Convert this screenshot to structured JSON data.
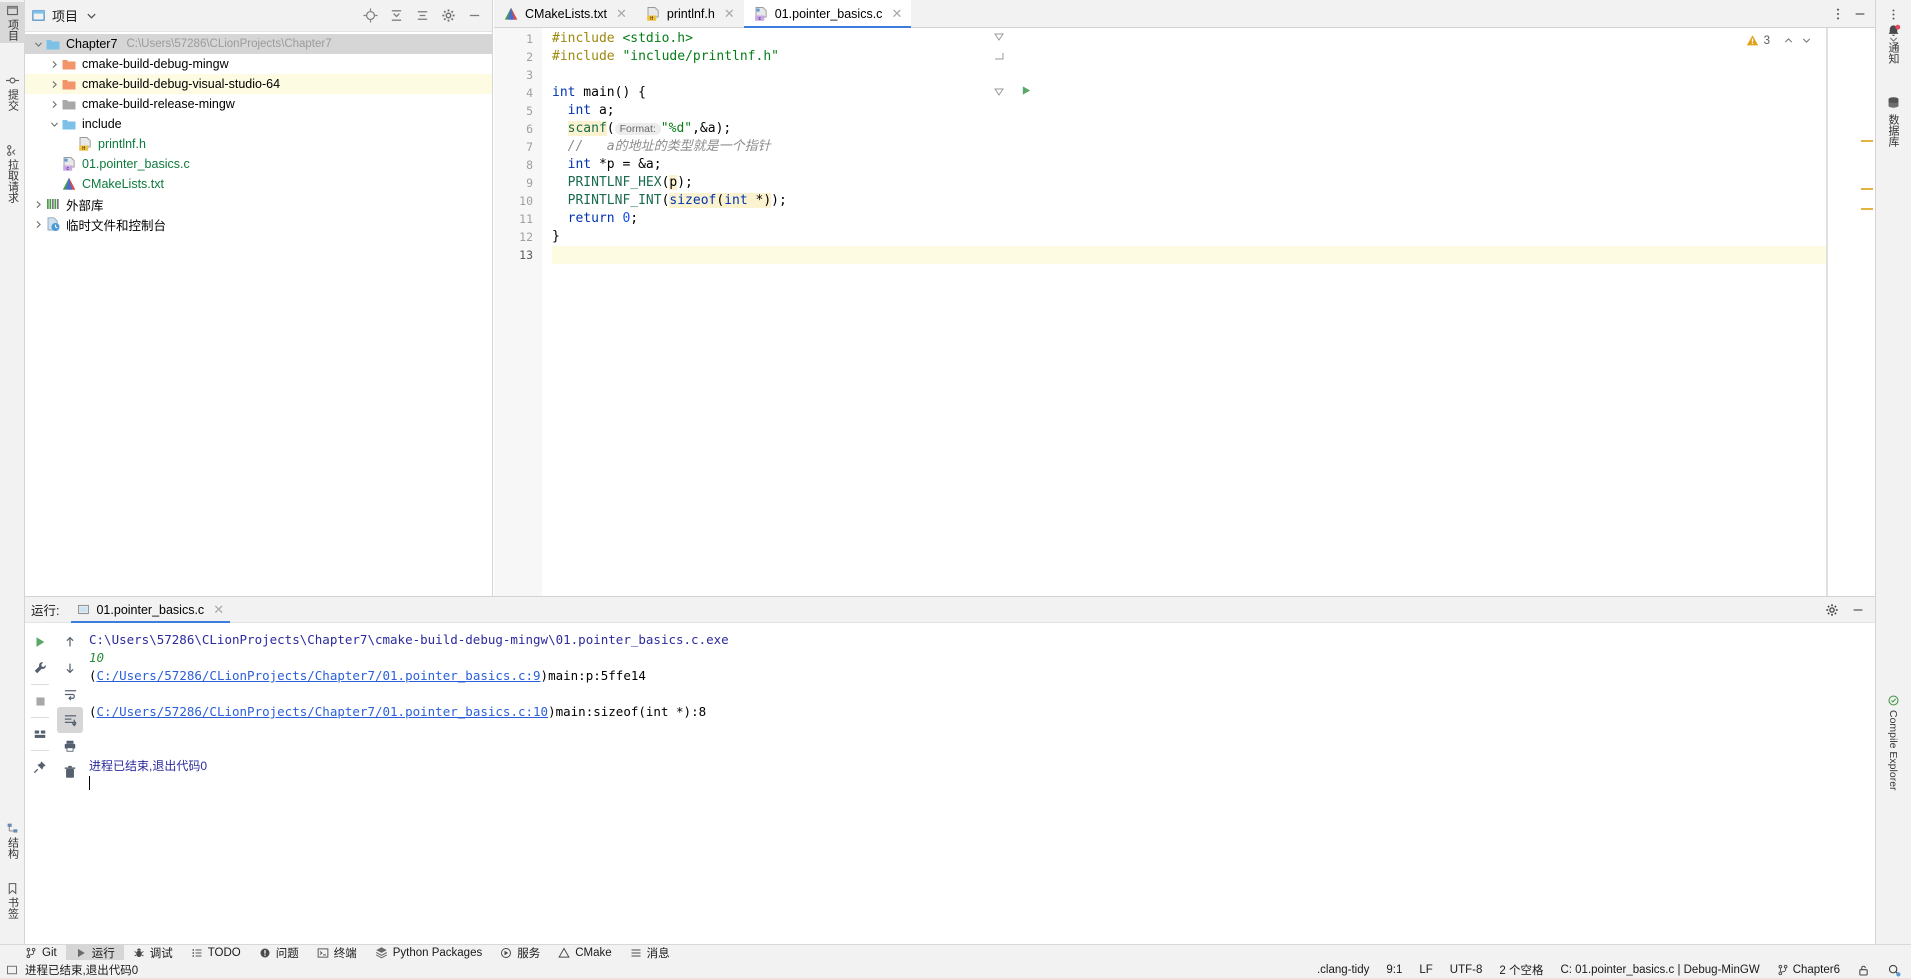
{
  "left_rail": {
    "items": [
      {
        "label": "项目",
        "icon": "project-icon",
        "selected": true
      },
      {
        "label": "提交",
        "icon": "commit-icon",
        "selected": false
      },
      {
        "label": "拉取请求",
        "icon": "pull-request-icon",
        "selected": false
      }
    ],
    "bottom_items": [
      {
        "label": "结构",
        "icon": "structure-icon"
      },
      {
        "label": "书签",
        "icon": "bookmarks-icon"
      }
    ]
  },
  "project_panel": {
    "title": "项目",
    "dropdown_icon": "chevron-down-icon",
    "header_icons": [
      "locate-icon",
      "collapse-all-icon",
      "expand-icon",
      "gear-icon",
      "minimize-icon"
    ],
    "tree": [
      {
        "label": "Chapter7",
        "path": "C:\\Users\\57286\\CLionProjects\\Chapter7",
        "icon": "folder-icon",
        "indent": 0,
        "arrow": "down",
        "state": "selected"
      },
      {
        "label": "cmake-build-debug-mingw",
        "icon": "folder-excluded-icon",
        "indent": 1,
        "arrow": "right",
        "state": "normal"
      },
      {
        "label": "cmake-build-debug-visual-studio-64",
        "icon": "folder-excluded-icon",
        "indent": 1,
        "arrow": "right",
        "state": "highlight"
      },
      {
        "label": "cmake-build-release-mingw",
        "icon": "folder-gray-icon",
        "indent": 1,
        "arrow": "right",
        "state": "normal"
      },
      {
        "label": "include",
        "icon": "folder-icon",
        "indent": 1,
        "arrow": "down",
        "state": "normal"
      },
      {
        "label": "printlnf.h",
        "icon": "header-file-icon",
        "indent": 2,
        "arrow": "none",
        "state": "normal",
        "color": "green"
      },
      {
        "label": "01.pointer_basics.c",
        "icon": "c-file-icon",
        "indent": 1,
        "arrow": "none",
        "state": "normal",
        "color": "green"
      },
      {
        "label": "CMakeLists.txt",
        "icon": "cmake-file-icon",
        "indent": 1,
        "arrow": "none",
        "state": "normal",
        "color": "green"
      },
      {
        "label": "外部库",
        "icon": "library-icon",
        "indent": 0,
        "arrow": "right",
        "state": "normal"
      },
      {
        "label": "临时文件和控制台",
        "icon": "scratches-icon",
        "indent": 0,
        "arrow": "right",
        "state": "normal"
      }
    ]
  },
  "editor": {
    "tabs": [
      {
        "label": "CMakeLists.txt",
        "icon": "cmake-file-icon",
        "active": false,
        "closable": true
      },
      {
        "label": "printlnf.h",
        "icon": "header-file-icon",
        "active": false,
        "closable": true
      },
      {
        "label": "01.pointer_basics.c",
        "icon": "c-file-icon",
        "active": true,
        "closable": true
      }
    ],
    "tab_right_icons": [
      "more-vertical-icon",
      "minimize-icon"
    ],
    "warning_count": "3",
    "warning_icon": "warning-triangle-icon",
    "nav_up_icon": "chevron-up-icon",
    "nav_down_icon": "chevron-down-icon",
    "line_numbers": [
      "1",
      "2",
      "3",
      "4",
      "5",
      "6",
      "7",
      "8",
      "9",
      "10",
      "11",
      "12",
      "13"
    ],
    "current_line": "13",
    "code_lines": [
      {
        "n": 1,
        "tokens": [
          {
            "t": "#include ",
            "c": "pp"
          },
          {
            "t": "<stdio.h>",
            "c": "str"
          }
        ]
      },
      {
        "n": 2,
        "tokens": [
          {
            "t": "#include ",
            "c": "pp"
          },
          {
            "t": "\"include/printlnf.h\"",
            "c": "str"
          }
        ]
      },
      {
        "n": 3,
        "tokens": []
      },
      {
        "n": 4,
        "tokens": [
          {
            "t": "int",
            "c": "k"
          },
          {
            "t": " main() {",
            "c": ""
          }
        ]
      },
      {
        "n": 5,
        "tokens": [
          {
            "t": "  ",
            "c": ""
          },
          {
            "t": "int",
            "c": "k"
          },
          {
            "t": " a;",
            "c": ""
          }
        ]
      },
      {
        "n": 6,
        "tokens": [
          {
            "t": "  ",
            "c": ""
          },
          {
            "t": "scanf",
            "c": "mac-hl"
          },
          {
            "t": "(",
            "c": ""
          },
          {
            "t": "Format:",
            "c": "inlay"
          },
          {
            "t": "\"%d\"",
            "c": "str"
          },
          {
            "t": ",&a);",
            "c": ""
          }
        ]
      },
      {
        "n": 7,
        "tokens": [
          {
            "t": "  //   a的地址的类型就是一个指针",
            "c": "cmt"
          }
        ]
      },
      {
        "n": 8,
        "tokens": [
          {
            "t": "  ",
            "c": ""
          },
          {
            "t": "int",
            "c": "k"
          },
          {
            "t": " *p = &a;",
            "c": ""
          }
        ]
      },
      {
        "n": 9,
        "tokens": [
          {
            "t": "  ",
            "c": ""
          },
          {
            "t": "PRINTLNF_HEX",
            "c": "mac"
          },
          {
            "t": "(",
            "c": ""
          },
          {
            "t": "p",
            "c": "hl"
          },
          {
            "t": ");",
            "c": ""
          }
        ]
      },
      {
        "n": 10,
        "tokens": [
          {
            "t": "  ",
            "c": ""
          },
          {
            "t": "PRINTLNF_INT",
            "c": "mac"
          },
          {
            "t": "(",
            "c": ""
          },
          {
            "t": "sizeof(int *)",
            "c": "hl-mixed"
          },
          {
            "t": ");",
            "c": ""
          }
        ]
      },
      {
        "n": 11,
        "tokens": [
          {
            "t": "  ",
            "c": ""
          },
          {
            "t": "return",
            "c": "k"
          },
          {
            "t": " ",
            "c": ""
          },
          {
            "t": "0",
            "c": "num"
          },
          {
            "t": ";",
            "c": ""
          }
        ]
      },
      {
        "n": 12,
        "tokens": [
          {
            "t": "}",
            "c": ""
          }
        ]
      },
      {
        "n": 13,
        "tokens": []
      }
    ]
  },
  "run_panel": {
    "label": "运行:",
    "tab_label": "01.pointer_basics.c",
    "tab_icon": "run-config-icon",
    "tab_close_icon": "close-icon",
    "header_right_icons": [
      "gear-icon",
      "minimize-icon"
    ],
    "toolbar_left": [
      {
        "icon": "rerun-icon",
        "name": "rerun-button"
      },
      {
        "icon": "wrench-icon",
        "name": "edit-configuration-button"
      },
      {
        "icon": "stop-icon",
        "name": "stop-button"
      },
      {
        "icon": "layout-icon",
        "name": "layout-button"
      },
      {
        "icon": "pin-icon",
        "name": "pin-button"
      }
    ],
    "toolbar_right": [
      {
        "icon": "arrow-up-icon",
        "name": "previous-occurrence-button"
      },
      {
        "icon": "arrow-down-icon",
        "name": "next-occurrence-button"
      },
      {
        "icon": "soft-wrap-icon",
        "name": "soft-wrap-button"
      },
      {
        "icon": "scroll-to-end-icon",
        "name": "scroll-to-end-button",
        "active": true
      },
      {
        "icon": "print-icon",
        "name": "print-button"
      },
      {
        "icon": "trash-icon",
        "name": "clear-all-button"
      }
    ],
    "console_lines": [
      {
        "kind": "cmd",
        "text": "C:\\Users\\57286\\CLionProjects\\Chapter7\\cmake-build-debug-mingw\\01.pointer_basics.c.exe"
      },
      {
        "kind": "input",
        "text": "10"
      },
      {
        "kind": "link",
        "prefix": "(",
        "link": "C:/Users/57286/CLionProjects/Chapter7/01.pointer_basics.c:9",
        "suffix": ")main:p:5ffe14"
      },
      {
        "kind": "blank",
        "text": ""
      },
      {
        "kind": "link",
        "prefix": "(",
        "link": "C:/Users/57286/CLionProjects/Chapter7/01.pointer_basics.c:10",
        "suffix": ")main:sizeof(int *):8"
      },
      {
        "kind": "blank",
        "text": ""
      },
      {
        "kind": "blank",
        "text": ""
      },
      {
        "kind": "exit",
        "text": "进程已结束,退出代码0"
      },
      {
        "kind": "caret",
        "text": ""
      }
    ]
  },
  "right_rail": {
    "items": [
      {
        "label": "通知",
        "icon": "bell-icon",
        "badge": true
      },
      {
        "label": "数据库",
        "icon": "database-icon"
      }
    ],
    "bottom_items": [
      {
        "label": "Compile Explorer",
        "icon": "compile-explorer-icon"
      }
    ],
    "top_icons": [
      "more-vertical-icon",
      "chevron-down-icon"
    ]
  },
  "status_bar": {
    "tool_buttons": [
      {
        "label": "Git",
        "icon": "git-branch-icon",
        "active": false
      },
      {
        "label": "运行",
        "icon": "run-icon",
        "active": true
      },
      {
        "label": "调试",
        "icon": "debug-icon",
        "active": false
      },
      {
        "label": "TODO",
        "icon": "todo-icon",
        "active": false
      },
      {
        "label": "问题",
        "icon": "problems-icon",
        "active": false
      },
      {
        "label": "终端",
        "icon": "terminal-icon",
        "active": false
      },
      {
        "label": "Python Packages",
        "icon": "python-packages-icon",
        "active": false
      },
      {
        "label": "服务",
        "icon": "services-icon",
        "active": false
      },
      {
        "label": "CMake",
        "icon": "cmake-icon",
        "active": false
      },
      {
        "label": "消息",
        "icon": "messages-icon",
        "active": false
      }
    ],
    "message": "进程已结束,退出代码0",
    "message_icon": "console-icon",
    "right": {
      "inspector": ".clang-tidy",
      "caret_position": "9:1",
      "line_separator": "LF",
      "encoding": "UTF-8",
      "indent": "2 个空格",
      "config": "C: 01.pointer_basics.c | Debug-MinGW",
      "branch": "Chapter6",
      "branch_icon": "git-branch-icon",
      "lock_icon": "lock-icon",
      "inspector_icon": "inspection-icon"
    }
  },
  "colors": {
    "accent": "#3c7ddd",
    "warning": "#e3a019",
    "link": "#2b5fd9",
    "green_file": "#0b7a3b",
    "highlight_yellow": "#fdfbe2",
    "selection_gray": "#d6d6d6"
  }
}
